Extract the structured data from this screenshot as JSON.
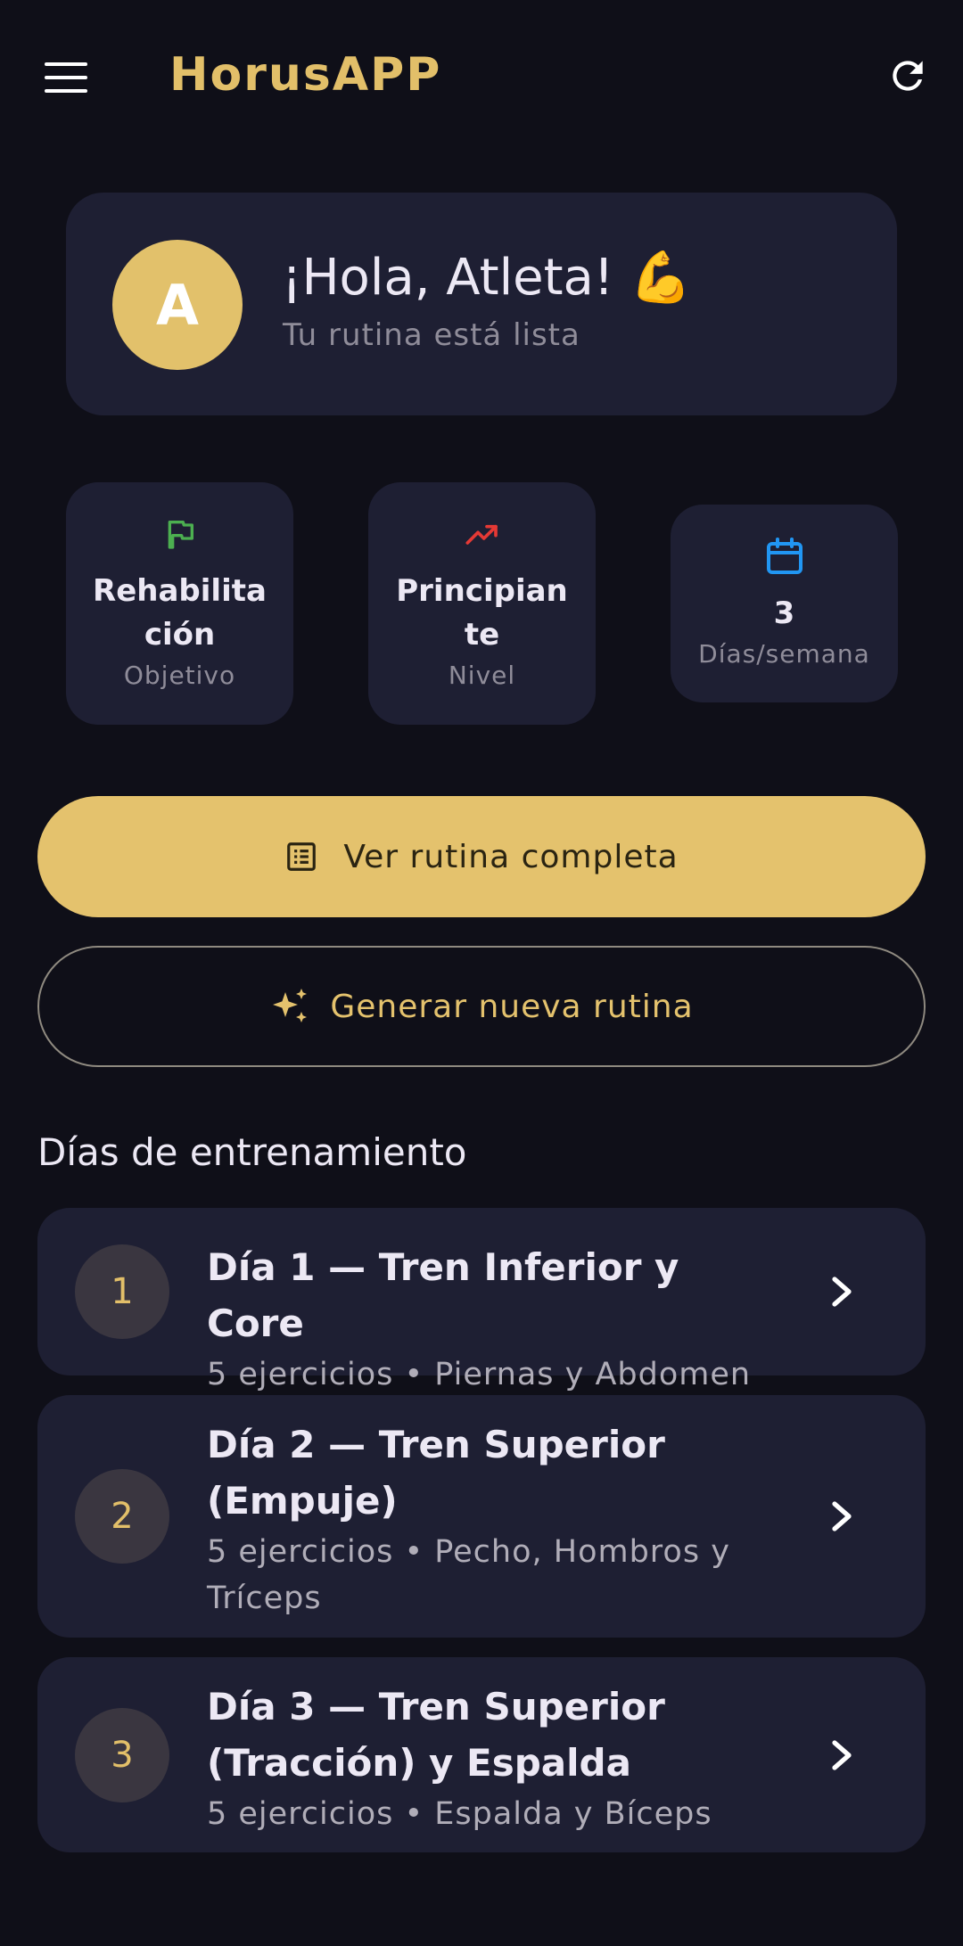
{
  "app": {
    "title": "HorusAPP"
  },
  "icons": {
    "menu": "menu-icon",
    "refresh": "refresh-icon",
    "goal": "flag-icon",
    "level": "trending-up-icon",
    "days": "calendar-icon",
    "routine": "list-icon",
    "generate": "sparkles-icon",
    "open_day": "chevron-right-icon"
  },
  "colors": {
    "accent": "#e2bf69",
    "background": "#0f0f18",
    "card": "#1e1f33",
    "goal_icon": "#4caf50",
    "level_icon": "#e53935",
    "days_icon": "#2196f3"
  },
  "greeting": {
    "avatar_letter": "A",
    "title": "¡Hola, Atleta! 💪",
    "subtitle": "Tu rutina está lista"
  },
  "stats": [
    {
      "value": "Rehabilitación",
      "label": "Objetivo"
    },
    {
      "value": "Principiante",
      "label": "Nivel"
    },
    {
      "value": "3",
      "label": "Días/semana"
    }
  ],
  "actions": {
    "view_routine": "Ver rutina completa",
    "generate_routine": "Generar nueva rutina"
  },
  "training_days": {
    "heading": "Días de entrenamiento",
    "items": [
      {
        "number": "1",
        "title": "Día 1 — Tren Inferior y Core",
        "subtitle": "5 ejercicios • Piernas y Abdomen"
      },
      {
        "number": "2",
        "title": "Día 2 — Tren Superior (Empuje)",
        "subtitle": "5 ejercicios • Pecho, Hombros y Tríceps"
      },
      {
        "number": "3",
        "title": "Día 3 — Tren Superior (Tracción) y Espalda",
        "subtitle": "5 ejercicios • Espalda y Bíceps"
      }
    ]
  }
}
